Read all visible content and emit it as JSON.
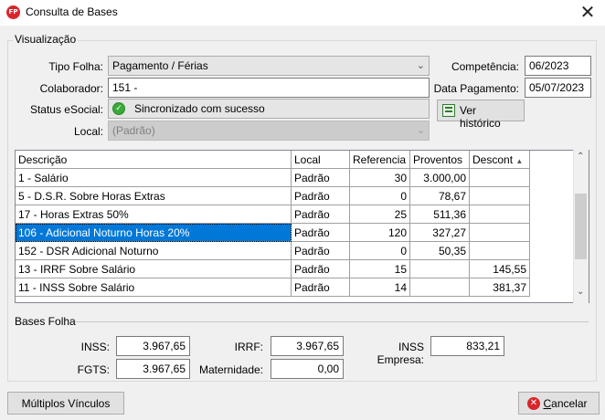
{
  "window": {
    "title": "Consulta de Bases",
    "app_badge": "FP",
    "close_glyph": "✕"
  },
  "visualizacao": {
    "legend": "Visualização",
    "tipo_folha_label": "Tipo Folha:",
    "tipo_folha_value": "Pagamento / Férias",
    "colaborador_label": "Colaborador:",
    "colaborador_value": "151 -",
    "status_label": "Status eSocial:",
    "status_value": "Sincronizado com sucesso",
    "local_label": "Local:",
    "local_value": "(Padrão)",
    "competencia_label": "Competência:",
    "competencia_value": "06/2023",
    "data_pagamento_label": "Data Pagamento:",
    "data_pagamento_value": "05/07/2023",
    "ver_historico_label": "Ver histórico"
  },
  "grid": {
    "headers": [
      "Descrição",
      "Local",
      "Referencia",
      "Proventos",
      "Descont"
    ],
    "sort_glyph": "▲",
    "rows": [
      {
        "descricao": "1 - Salário",
        "local": "Padrão",
        "referencia": "30",
        "proventos": "3.000,00",
        "descontos": ""
      },
      {
        "descricao": "5 - D.S.R. Sobre Horas Extras",
        "local": "Padrão",
        "referencia": "0",
        "proventos": "78,67",
        "descontos": ""
      },
      {
        "descricao": "17 - Horas Extras 50%",
        "local": "Padrão",
        "referencia": "25",
        "proventos": "511,36",
        "descontos": ""
      },
      {
        "descricao": "106 - Adicional Noturno Horas 20%",
        "local": "Padrão",
        "referencia": "120",
        "proventos": "327,27",
        "descontos": ""
      },
      {
        "descricao": "152 - DSR Adicional Noturno",
        "local": "Padrão",
        "referencia": "0",
        "proventos": "50,35",
        "descontos": ""
      },
      {
        "descricao": "13 - IRRF Sobre Salário",
        "local": "Padrão",
        "referencia": "15",
        "proventos": "",
        "descontos": "145,55"
      },
      {
        "descricao": "11 - INSS Sobre Salário",
        "local": "Padrão",
        "referencia": "14",
        "proventos": "",
        "descontos": "381,37"
      }
    ],
    "selected_row": 3
  },
  "bases_folha": {
    "title": "Bases Folha",
    "inss_label": "INSS:",
    "inss_value": "3.967,65",
    "fgts_label": "FGTS:",
    "fgts_value": "3.967,65",
    "irrf_label": "IRRF:",
    "irrf_value": "3.967,65",
    "maternidade_label": "Maternidade:",
    "maternidade_value": "0,00",
    "inss_empresa_label": "INSS Empresa:",
    "inss_empresa_value": "833,21"
  },
  "footer": {
    "multiplos_label": "Múltiplos Vínculos",
    "cancelar_label": "Cancelar",
    "cancelar_mnemonic": "C",
    "cancelar_rest": "ancelar"
  },
  "colors": {
    "selection": "#0078d7",
    "status_ok": "#3aa93a",
    "cancel_icon": "#d9262b"
  }
}
